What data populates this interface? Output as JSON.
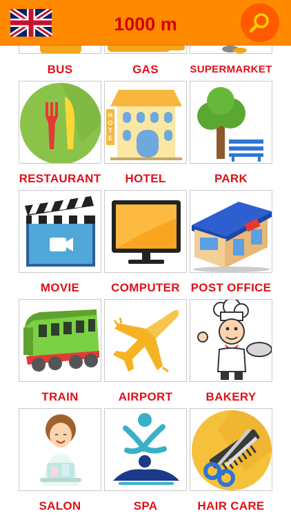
{
  "header": {
    "distance": "1000 m",
    "language_icon": "uk-flag-icon",
    "search_icon": "search-icon"
  },
  "categories": [
    {
      "label": "BUS",
      "icon": "bus-icon"
    },
    {
      "label": "GAS",
      "icon": "gas-pump-icon"
    },
    {
      "label": "SUPERMARKET",
      "icon": "shopping-cart-icon"
    },
    {
      "label": "RESTAURANT",
      "icon": "fork-knife-icon"
    },
    {
      "label": "HOTEL",
      "icon": "hotel-building-icon"
    },
    {
      "label": "PARK",
      "icon": "tree-bench-icon"
    },
    {
      "label": "MOVIE",
      "icon": "clapperboard-icon"
    },
    {
      "label": "COMPUTER",
      "icon": "monitor-icon"
    },
    {
      "label": "POST OFFICE",
      "icon": "post-office-building-icon"
    },
    {
      "label": "TRAIN",
      "icon": "train-icon"
    },
    {
      "label": "AIRPORT",
      "icon": "airplane-icon"
    },
    {
      "label": "BAKERY",
      "icon": "chef-icon"
    },
    {
      "label": "SALON",
      "icon": "salon-woman-icon"
    },
    {
      "label": "SPA",
      "icon": "spa-massage-icon"
    },
    {
      "label": "HAIR CARE",
      "icon": "comb-scissors-icon"
    }
  ],
  "colors": {
    "header_bg": "#ff8a00",
    "title": "#d4000a",
    "search_bg": "#ff5a00",
    "label": "#e0101a"
  }
}
